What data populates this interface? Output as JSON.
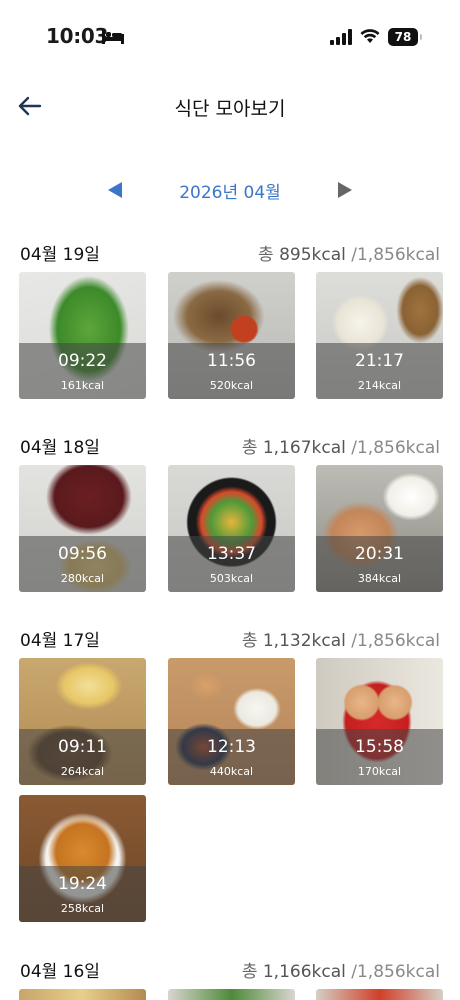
{
  "status_bar": {
    "time": "10:03",
    "battery": "78"
  },
  "header": {
    "title": "식단 모아보기"
  },
  "month_nav": {
    "label": "2026년 04월"
  },
  "days": [
    {
      "date": "04월 19일",
      "total_prefix": "총",
      "consumed": "895kcal",
      "goal": "/1,856kcal",
      "meals": [
        {
          "time": "09:22",
          "kcal": "161kcal"
        },
        {
          "time": "11:56",
          "kcal": "520kcal"
        },
        {
          "time": "21:17",
          "kcal": "214kcal"
        }
      ]
    },
    {
      "date": "04월 18일",
      "total_prefix": "총",
      "consumed": "1,167kcal",
      "goal": "/1,856kcal",
      "meals": [
        {
          "time": "09:56",
          "kcal": "280kcal"
        },
        {
          "time": "13:37",
          "kcal": "503kcal"
        },
        {
          "time": "20:31",
          "kcal": "384kcal"
        }
      ]
    },
    {
      "date": "04월 17일",
      "total_prefix": "총",
      "consumed": "1,132kcal",
      "goal": "/1,856kcal",
      "meals": [
        {
          "time": "09:11",
          "kcal": "264kcal"
        },
        {
          "time": "12:13",
          "kcal": "440kcal"
        },
        {
          "time": "15:58",
          "kcal": "170kcal"
        },
        {
          "time": "19:24",
          "kcal": "258kcal"
        }
      ]
    },
    {
      "date": "04월 16일",
      "total_prefix": "총",
      "consumed": "1,166kcal",
      "goal": "/1,856kcal",
      "meals": []
    }
  ]
}
